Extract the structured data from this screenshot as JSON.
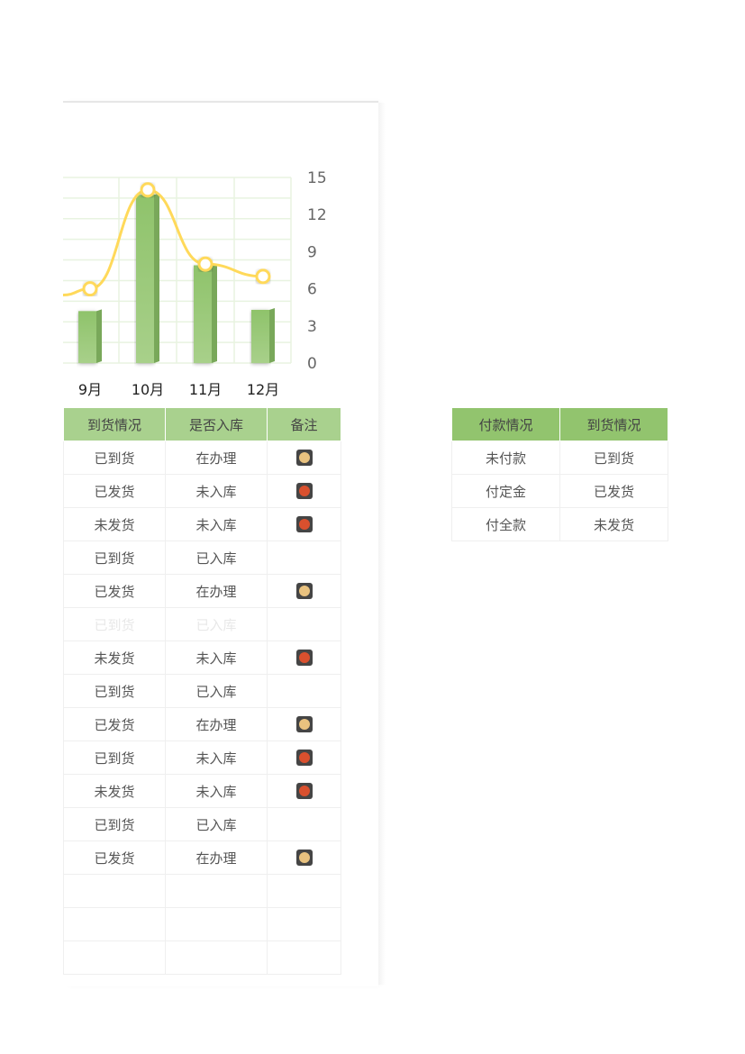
{
  "chart_data": {
    "type": "bar+line",
    "categories": [
      "9月",
      "10月",
      "11月",
      "12月"
    ],
    "series": [
      {
        "type": "bar",
        "values": [
          4.2,
          13.6,
          7.9,
          4.3
        ],
        "color": "#8fc36b"
      },
      {
        "type": "line",
        "values": [
          6,
          14,
          8,
          7
        ],
        "color": "#ffd95a",
        "previous_offscreen_value": 5.5
      }
    ],
    "y_axis": {
      "position": "right",
      "ticks": [
        0,
        3,
        6,
        9,
        12,
        15
      ],
      "range": [
        0,
        15
      ]
    },
    "grid": true
  },
  "table_main": {
    "headers": [
      "到货情况",
      "是否入库",
      "备注"
    ],
    "rows": [
      {
        "arrival": "已到货",
        "storage": "在办理",
        "note": "yellow"
      },
      {
        "arrival": "已发货",
        "storage": "未入库",
        "note": "red"
      },
      {
        "arrival": "未发货",
        "storage": "未入库",
        "note": "red"
      },
      {
        "arrival": "已到货",
        "storage": "已入库",
        "note": ""
      },
      {
        "arrival": "已发货",
        "storage": "在办理",
        "note": "yellow"
      },
      {
        "arrival": "已到货",
        "storage": "已入库",
        "note": "",
        "faded": true
      },
      {
        "arrival": "未发货",
        "storage": "未入库",
        "note": "red"
      },
      {
        "arrival": "已到货",
        "storage": "已入库",
        "note": ""
      },
      {
        "arrival": "已发货",
        "storage": "在办理",
        "note": "yellow"
      },
      {
        "arrival": "已到货",
        "storage": "未入库",
        "note": "red"
      },
      {
        "arrival": "未发货",
        "storage": "未入库",
        "note": "red"
      },
      {
        "arrival": "已到货",
        "storage": "已入库",
        "note": ""
      },
      {
        "arrival": "已发货",
        "storage": "在办理",
        "note": "yellow"
      },
      {
        "arrival": "",
        "storage": "",
        "note": ""
      },
      {
        "arrival": "",
        "storage": "",
        "note": ""
      },
      {
        "arrival": "",
        "storage": "",
        "note": ""
      }
    ],
    "status_colors": {
      "yellow": "#e9c27f",
      "red": "#d9502e"
    }
  },
  "table_legend": {
    "headers": [
      "付款情况",
      "到货情况"
    ],
    "rows": [
      [
        "未付款",
        "已到货"
      ],
      [
        "付定金",
        "已发货"
      ],
      [
        "付全款",
        "未发货"
      ]
    ]
  }
}
